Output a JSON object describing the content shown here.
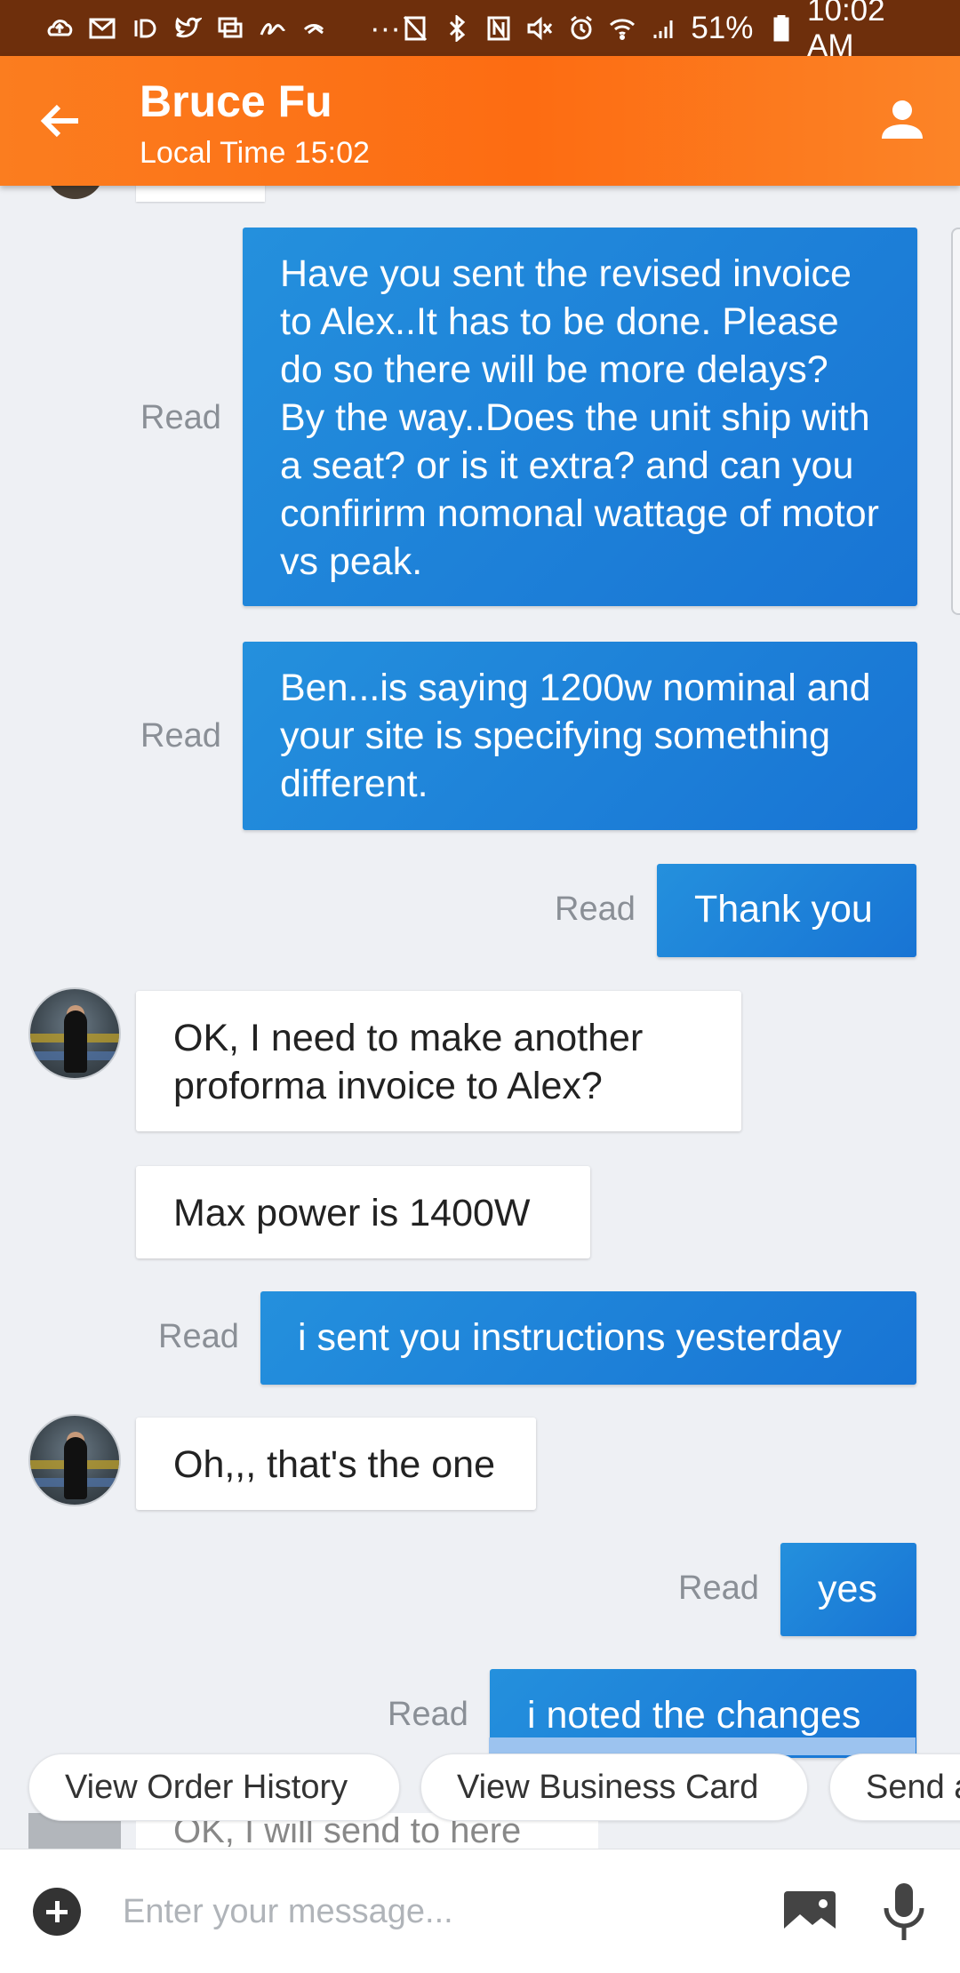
{
  "status_bar": {
    "battery": "51%",
    "time": "10:02 AM",
    "ellipsis": "···",
    "icons_left": [
      "cloud-upload-icon",
      "gmail-icon",
      "tidal-icon",
      "twitter-icon",
      "gallery-icon",
      "signature-icon",
      "swipe-icon"
    ],
    "icons_right": [
      "no-sim-icon",
      "bluetooth-icon",
      "nfc-icon",
      "mute-icon",
      "alarm-icon",
      "wifi-icon",
      "signal-icon",
      "battery-icon"
    ]
  },
  "header": {
    "contact_name": "Bruce Fu",
    "local_time": "Local Time 15:02"
  },
  "messages": [
    {
      "direction": "out",
      "status": "Read",
      "text": "Have you sent the revised invoice to Alex..It has to be done.  Please do so there will be more delays? By the way..Does the unit ship with a seat? or is it extra? and can you confirirm nomonal wattage of motor vs peak."
    },
    {
      "direction": "out",
      "status": "Read",
      "text": "Ben...is saying 1200w nominal and your site is specifying something different."
    },
    {
      "direction": "out",
      "status": "Read",
      "text": "Thank you"
    },
    {
      "direction": "in",
      "text": "OK, I need to make another proforma invoice to Alex?"
    },
    {
      "direction": "in",
      "text": "Max power is 1400W"
    },
    {
      "direction": "out",
      "status": "Read",
      "text": "i sent you instructions yesterday"
    },
    {
      "direction": "in",
      "text": "Oh,,, that's the one"
    },
    {
      "direction": "out",
      "status": "Read",
      "text": "yes"
    },
    {
      "direction": "out",
      "status": "Read",
      "text": "i noted the changes"
    },
    {
      "direction": "in",
      "text": "OK, I will send to here"
    }
  ],
  "quick_actions": [
    "View Order History",
    "View Business Card",
    "Send a"
  ],
  "input": {
    "placeholder": "Enter your message..."
  },
  "colors": {
    "header_orange": "#fd7015",
    "outgoing_blue": "#1e82d8",
    "status_bar": "#6e2f0c"
  }
}
